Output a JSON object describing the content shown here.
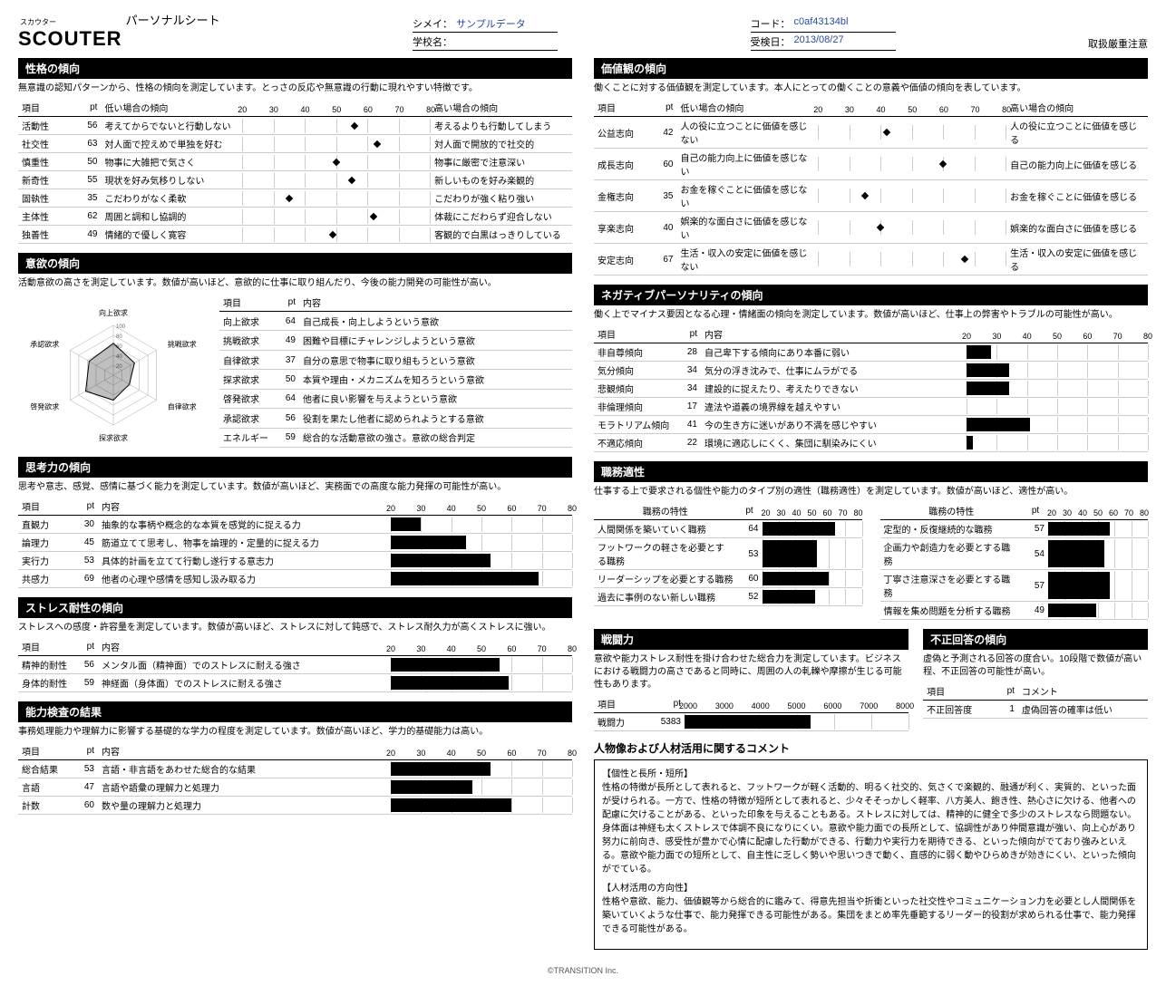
{
  "header": {
    "logo_ruby": "スカウター",
    "logo_main": "SCOUTER",
    "logo_sub": "パーソナルシート",
    "meta1_label": "シメイ：",
    "meta1_value": "サンプルデータ",
    "meta2_label": "学校名：",
    "meta2_value": "",
    "meta3_label": "コード：",
    "meta3_value": "c0af43134bl",
    "meta4_label": "受検日：",
    "meta4_value": "2013/08/27",
    "warn": "取扱厳重注意"
  },
  "ticks_20_80": [
    "20",
    "30",
    "40",
    "50",
    "60",
    "70",
    "80"
  ],
  "s1": {
    "title": "性格の傾向",
    "desc": "無意識の認知パターンから、性格の傾向を測定しています。とっさの反応や無意識の行動に現れやすい特徴です。",
    "cols": {
      "item": "項目",
      "pt": "pt",
      "low": "低い場合の傾向",
      "high": "高い場合の傾向"
    },
    "rows": [
      {
        "item": "活動性",
        "pt": 56,
        "low": "考えてからでないと行動しない",
        "high": "考えるよりも行動してしまう"
      },
      {
        "item": "社交性",
        "pt": 63,
        "low": "対人面で控えめで単独を好む",
        "high": "対人面で開放的で社交的"
      },
      {
        "item": "慎重性",
        "pt": 50,
        "low": "物事に大雑把で気さく",
        "high": "物事に厳密で注意深い"
      },
      {
        "item": "新奇性",
        "pt": 55,
        "low": "現状を好み気移りしない",
        "high": "新しいものを好み楽観的"
      },
      {
        "item": "固執性",
        "pt": 35,
        "low": "こだわりがなく柔軟",
        "high": "こだわりが強く粘り強い"
      },
      {
        "item": "主体性",
        "pt": 62,
        "low": "周囲と調和し協調的",
        "high": "体裁にこだわらず迎合しない"
      },
      {
        "item": "独善性",
        "pt": 49,
        "low": "情緒的で優しく寛容",
        "high": "客観的で白黒はっきりしている"
      }
    ]
  },
  "s2": {
    "title": "意欲の傾向",
    "desc": "活動意欲の高さを測定しています。数値が高いほど、意欲的に仕事に取り組んだり、今後の能力開発の可能性が高い。",
    "cols": {
      "item": "項目",
      "pt": "pt",
      "content": "内容"
    },
    "radar_labels": [
      "向上欲求",
      "挑戦欲求",
      "自律欲求",
      "探求欲求",
      "啓発欲求",
      "承認欲求"
    ],
    "radar_ticks": [
      "20",
      "40",
      "60",
      "80",
      "100"
    ],
    "rows": [
      {
        "item": "向上欲求",
        "pt": 64,
        "content": "自己成長・向上しようという意欲"
      },
      {
        "item": "挑戦欲求",
        "pt": 49,
        "content": "困難や目標にチャレンジしようという意欲"
      },
      {
        "item": "自律欲求",
        "pt": 37,
        "content": "自分の意思で物事に取り組もうという意欲"
      },
      {
        "item": "探求欲求",
        "pt": 50,
        "content": "本質や理由・メカニズムを知ろうという意欲"
      },
      {
        "item": "啓発欲求",
        "pt": 64,
        "content": "他者に良い影響を与えようという意欲"
      },
      {
        "item": "承認欲求",
        "pt": 56,
        "content": "役割を果たし他者に認められようとする意欲"
      },
      {
        "item": "エネルギー",
        "pt": 59,
        "content": "総合的な活動意欲の強さ。意欲の総合判定"
      }
    ]
  },
  "s3": {
    "title": "思考力の傾向",
    "desc": "思考や意志、感覚、感情に基づく能力を測定しています。数値が高いほど、実務面での高度な能力発揮の可能性が高い。",
    "cols": {
      "item": "項目",
      "pt": "pt",
      "content": "内容"
    },
    "rows": [
      {
        "item": "直観力",
        "pt": 30,
        "content": "抽象的な事柄や概念的な本質を感覚的に捉える力"
      },
      {
        "item": "論理力",
        "pt": 45,
        "content": "筋道立てて思考し、物事を論理的・定量的に捉える力"
      },
      {
        "item": "実行力",
        "pt": 53,
        "content": "具体的計画を立てて行動し遂行する意志力"
      },
      {
        "item": "共感力",
        "pt": 69,
        "content": "他者の心理や感情を感知し汲み取る力"
      }
    ]
  },
  "s4": {
    "title": "ストレス耐性の傾向",
    "desc": "ストレスへの感度・許容量を測定しています。数値が高いほど、ストレスに対して鈍感で、ストレス耐久力が高くストレスに強い。",
    "cols": {
      "item": "項目",
      "pt": "pt",
      "content": "内容"
    },
    "rows": [
      {
        "item": "精神的耐性",
        "pt": 56,
        "content": "メンタル面（精神面）でのストレスに耐える強さ"
      },
      {
        "item": "身体的耐性",
        "pt": 59,
        "content": "神経面（身体面）でのストレスに耐える強さ"
      }
    ]
  },
  "s5": {
    "title": "能力検査の結果",
    "desc": "事務処理能力や理解力に影響する基礎的な学力の程度を測定しています。数値が高いほど、学力的基礎能力は高い。",
    "cols": {
      "item": "項目",
      "pt": "pt",
      "content": "内容"
    },
    "rows": [
      {
        "item": "総合結果",
        "pt": 53,
        "content": "言語・非言語をあわせた総合的な結果"
      },
      {
        "item": "言語",
        "pt": 47,
        "content": "言語や語彙の理解力と処理力"
      },
      {
        "item": "計数",
        "pt": 60,
        "content": "数や量の理解力と処理力"
      }
    ]
  },
  "s6": {
    "title": "価値観の傾向",
    "desc": "働くことに対する価値観を測定しています。本人にとっての働くことの意義や価値の傾向を表しています。",
    "cols": {
      "item": "項目",
      "pt": "pt",
      "low": "低い場合の傾向",
      "high": "高い場合の傾向"
    },
    "rows": [
      {
        "item": "公益志向",
        "pt": 42,
        "low": "人の役に立つことに価値を感じない",
        "high": "人の役に立つことに価値を感じる"
      },
      {
        "item": "成長志向",
        "pt": 60,
        "low": "自己の能力向上に価値を感じない",
        "high": "自己の能力向上に価値を感じる"
      },
      {
        "item": "金権志向",
        "pt": 35,
        "low": "お金を稼ぐことに価値を感じない",
        "high": "お金を稼ぐことに価値を感じる"
      },
      {
        "item": "享楽志向",
        "pt": 40,
        "low": "娯楽的な面白さに価値を感じない",
        "high": "娯楽的な面白さに価値を感じる"
      },
      {
        "item": "安定志向",
        "pt": 67,
        "low": "生活・収入の安定に価値を感じない",
        "high": "生活・収入の安定に価値を感じる"
      }
    ]
  },
  "s7": {
    "title": "ネガティブパーソナリティの傾向",
    "desc": "働く上でマイナス要因となる心理・情緒面の傾向を測定しています。数値が高いほど、仕事上の弊害やトラブルの可能性が高い。",
    "cols": {
      "item": "項目",
      "pt": "pt",
      "content": "内容"
    },
    "rows": [
      {
        "item": "非自尊傾向",
        "pt": 28,
        "content": "自己卑下する傾向にあり本番に弱い"
      },
      {
        "item": "気分傾向",
        "pt": 34,
        "content": "気分の浮き沈みで、仕事にムラがでる"
      },
      {
        "item": "悲観傾向",
        "pt": 34,
        "content": "建設的に捉えたり、考えたりできない"
      },
      {
        "item": "非倫理傾向",
        "pt": 17,
        "content": "違法や道義の境界線を越えやすい"
      },
      {
        "item": "モラトリアム傾向",
        "pt": 41,
        "content": "今の生き方に迷いがあり不満を感じやすい"
      },
      {
        "item": "不適応傾向",
        "pt": 22,
        "content": "環境に適応しにくく、集団に馴染みにくい"
      }
    ]
  },
  "s8": {
    "title": "職務適性",
    "desc": "仕事する上で要求される個性や能力のタイプ別の適性（職務適性）を測定しています。数値が高いほど、適性が高い。",
    "left_title": "職務の特性",
    "right_title": "職務の特性",
    "cols": {
      "pt": "pt"
    },
    "left": [
      {
        "item": "人間関係を築いていく職務",
        "pt": 64
      },
      {
        "item": "フットワークの軽さを必要とする職務",
        "pt": 53
      },
      {
        "item": "リーダーシップを必要とする職務",
        "pt": 60
      },
      {
        "item": "過去に事例のない新しい職務",
        "pt": 52
      }
    ],
    "right": [
      {
        "item": "定型的・反復継続的な職務",
        "pt": 57
      },
      {
        "item": "企画力や創造力を必要とする職務",
        "pt": 54
      },
      {
        "item": "丁寧さ注意深さを必要とする職務",
        "pt": 57
      },
      {
        "item": "情報を集め問題を分析する職務",
        "pt": 49
      }
    ]
  },
  "s9": {
    "title": "戦闘力",
    "desc": "意欲や能力ストレス耐性を掛け合わせた総合力を測定しています。ビジネスにおける戦闘力の高さであると同時に、周囲の人の軋轢や摩擦が生じる可能性もあります。",
    "cols": {
      "item": "項目",
      "pt": "pt"
    },
    "ticks": [
      "2000",
      "3000",
      "4000",
      "5000",
      "6000",
      "7000",
      "8000"
    ],
    "rows": [
      {
        "item": "戦闘力",
        "pt": 5383
      }
    ]
  },
  "s10": {
    "title": "不正回答の傾向",
    "desc": "虚偽と予測される回答の度合い。10段階で数値が高い程、不正回答の可能性が高い。",
    "cols": {
      "item": "項目",
      "pt": "pt",
      "comment": "コメント"
    },
    "rows": [
      {
        "item": "不正回答度",
        "pt": 1,
        "comment": "虚偽回答の確率は低い"
      }
    ]
  },
  "s11": {
    "title": "人物像および人材活用に関するコメント",
    "h1": "【個性と長所・短所】",
    "p1": "性格の特徴が長所として表れると、フットワークが軽く活動的、明るく社交的、気さくで楽観的、融通が利く、実質的、といった面が受けられる。一方で、性格の特徴が短所として表れると、少々そそっかしく軽率、八方美人、飽き性、熱心さに欠ける、他者への配慮に欠けることがある、といった印象を与えることもある。ストレスに対しては、精神的に健全で多少のストレスなら問題ない。身体面は神経も太くストレスで体調不良になりにくい。意欲や能力面での長所として、協調性があり仲間意識が強い、向上心があり努力に前向き、感受性が豊かで心情に配慮した行動ができる、行動力や実行力を期待できる、といった傾向がでており強みといえる。意欲や能力面での短所として、自主性に乏しく勢いや思いつきで動く、直感的に弱く動やひらめきが効きにくい、といった傾向がでている。",
    "h2": "【人材活用の方向性】",
    "p2": "性格や意欲、能力、価値観等から総合的に鑑みて、得意先担当や折衝といった社交性やコミュニケーション力を必要とし人間関係を築いていくような仕事で、能力発揮できる可能性がある。集団をまとめ率先垂範するリーダー的役割が求められる仕事で、能力発揮できる可能性がある。"
  },
  "footer": "©TRANSITION Inc."
}
